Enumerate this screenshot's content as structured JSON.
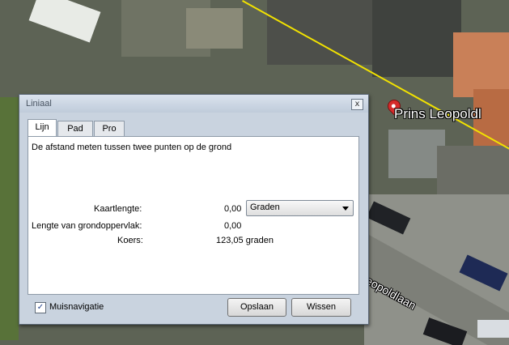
{
  "map": {
    "place_label": "Prins Leopoldl",
    "street_label": "eopoldlaan"
  },
  "dialog": {
    "title": "Liniaal",
    "close_glyph": "x",
    "tabs": [
      {
        "label": "Lijn",
        "active": true
      },
      {
        "label": "Pad",
        "active": false
      },
      {
        "label": "Pro",
        "active": false
      }
    ],
    "description": "De afstand meten tussen twee punten op de grond",
    "rows": [
      {
        "label": "Kaartlengte:",
        "value": "0,00"
      },
      {
        "label": "Lengte van grondoppervlak:",
        "value": "0,00"
      },
      {
        "label": "Koers:",
        "value": "123,05 graden"
      }
    ],
    "unit_select": {
      "selected": "Graden"
    },
    "mouse_nav": {
      "label": "Muisnavigatie",
      "checked": true,
      "check_glyph": "✓"
    },
    "buttons": {
      "save": "Opslaan",
      "clear": "Wissen"
    }
  }
}
